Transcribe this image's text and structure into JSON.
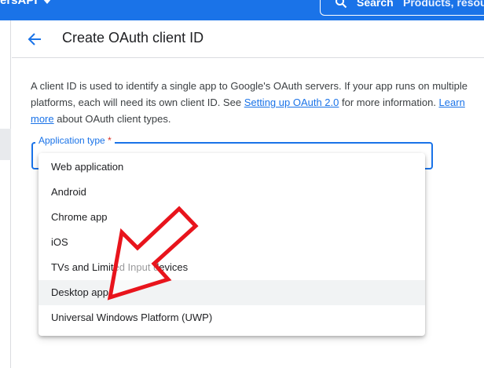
{
  "topbar": {
    "project_name": "ersAPI",
    "search_label": "Search",
    "search_placeholder": "Products, resou"
  },
  "header": {
    "title": "Create OAuth client ID"
  },
  "description": {
    "text_1": "A client ID is used to identify a single app to Google's OAuth servers. If your app runs on multiple platforms, each will need its own client ID. See ",
    "link_1": "Setting up OAuth 2.0",
    "text_2": " for more information. ",
    "link_2": "Learn more",
    "text_3": " about OAuth client types."
  },
  "form": {
    "application_type_label": "Application type",
    "required_marker": "*"
  },
  "dropdown": {
    "options": [
      {
        "label": "Web application"
      },
      {
        "label": "Android"
      },
      {
        "label": "Chrome app"
      },
      {
        "label": "iOS"
      },
      {
        "label": "TVs and Limited Input devices"
      },
      {
        "label": "Desktop app"
      },
      {
        "label": "Universal Windows Platform (UWP)"
      }
    ],
    "highlighted": "Desktop app"
  },
  "colors": {
    "primary": "#1a73e8",
    "annotation_arrow": "#e8141c",
    "required": "#d93025"
  }
}
